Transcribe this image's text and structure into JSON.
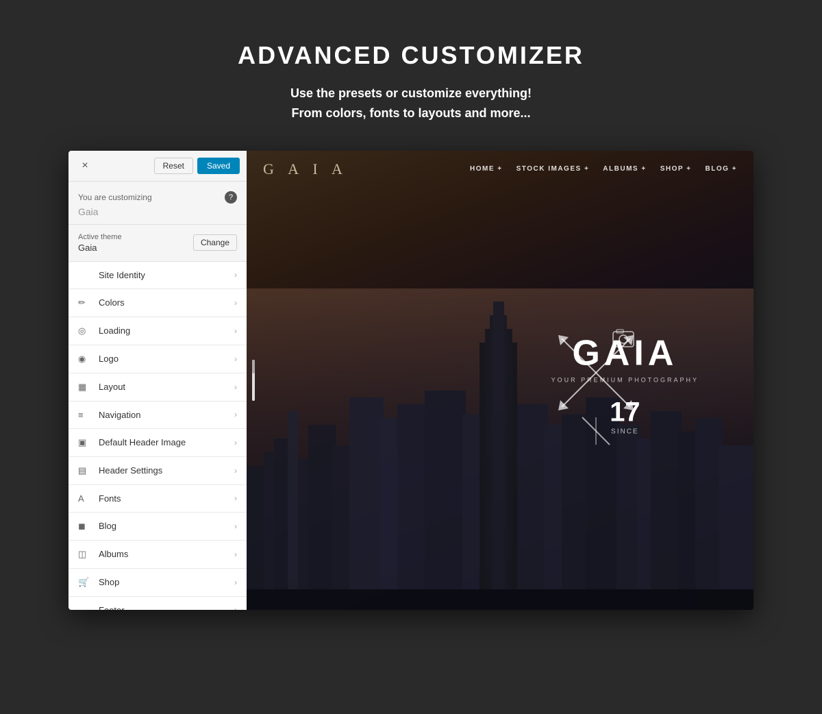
{
  "page": {
    "title": "ADVANCED CUSTOMIZER",
    "subtitle_line1": "Use the presets or customize everything!",
    "subtitle_line2": "From colors, fonts to layouts and more..."
  },
  "topbar": {
    "close_label": "×",
    "reset_label": "Reset",
    "saved_label": "Saved"
  },
  "customizing": {
    "label": "You are customizing",
    "site_name": "Gaia",
    "help_icon": "?"
  },
  "theme": {
    "active_label": "Active theme",
    "name": "Gaia",
    "change_label": "Change"
  },
  "menu_items": [
    {
      "id": "site-identity",
      "icon": "",
      "label": "Site Identity"
    },
    {
      "id": "colors",
      "icon": "✏",
      "label": "Colors"
    },
    {
      "id": "loading",
      "icon": "◎",
      "label": "Loading"
    },
    {
      "id": "logo",
      "icon": "◉",
      "label": "Logo"
    },
    {
      "id": "layout",
      "icon": "▦",
      "label": "Layout"
    },
    {
      "id": "navigation",
      "icon": "≡",
      "label": "Navigation"
    },
    {
      "id": "default-header-image",
      "icon": "▣",
      "label": "Default Header Image"
    },
    {
      "id": "header-settings",
      "icon": "▤",
      "label": "Header Settings"
    },
    {
      "id": "fonts",
      "icon": "A",
      "label": "Fonts"
    },
    {
      "id": "blog",
      "icon": "◼",
      "label": "Blog"
    },
    {
      "id": "albums",
      "icon": "◫",
      "label": "Albums"
    },
    {
      "id": "shop",
      "icon": "🛒",
      "label": "Shop"
    },
    {
      "id": "footer",
      "icon": "—",
      "label": "Footer"
    }
  ],
  "preview": {
    "logo": "G A I A",
    "nav_links": [
      "HOME +",
      "STOCK IMAGES +",
      "ALBUMS +",
      "SHOP +",
      "BLOG +"
    ],
    "site_title": "GAIA",
    "tagline": "YOUR PREMIUM PHOTOGRAPHY",
    "number": "17",
    "since_label": "SINCE"
  }
}
